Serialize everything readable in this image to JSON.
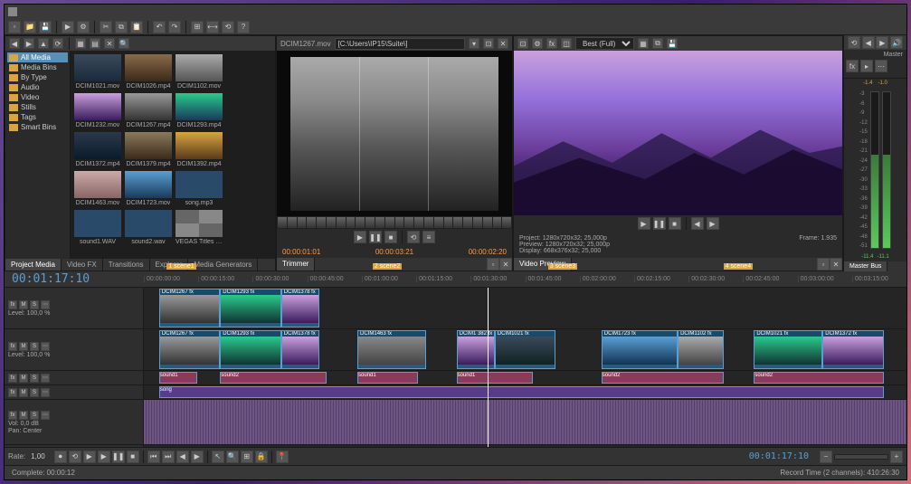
{
  "titlebar": {
    "app_icon": "□"
  },
  "media": {
    "tree": [
      "All Media",
      "Media Bins",
      "By Type",
      "Audio",
      "Video",
      "Stills",
      "Tags",
      "Smart Bins"
    ],
    "thumbs": [
      {
        "label": "DCIM1021.mov",
        "bg": "linear-gradient(#3a4a5a,#1a2a3a)"
      },
      {
        "label": "DCIM1026.mp4",
        "bg": "linear-gradient(#8a6a4a,#3a2a1a)"
      },
      {
        "label": "DCIM1102.mov",
        "bg": "linear-gradient(#aaa,#555)"
      },
      {
        "label": "DCIM1232.mov",
        "bg": "linear-gradient(#c9a0dc,#3a1c5e)"
      },
      {
        "label": "DCIM1267.mp4",
        "bg": "linear-gradient(#999,#333)"
      },
      {
        "label": "DCIM1293.mp4",
        "bg": "linear-gradient(#2aca8a,#1a3a5a)"
      },
      {
        "label": "DCIM1372.mp4",
        "bg": "linear-gradient(#2a3a4a,#0a1a2a)"
      },
      {
        "label": "DCIM1379.mp4",
        "bg": "linear-gradient(#8a7a5a,#3a2a1a)"
      },
      {
        "label": "DCIM1392.mp4",
        "bg": "linear-gradient(#d9a441,#5a3a1a)"
      },
      {
        "label": "DCIM1463.mov",
        "bg": "linear-gradient(#caa,#866)"
      },
      {
        "label": "DCIM1723.mov",
        "bg": "linear-gradient(#5a9fd4,#1a3a5a)"
      },
      {
        "label": "song.mp3",
        "bg": "#2a4a6a"
      },
      {
        "label": "sound1.WAV",
        "bg": "#2a4a6a"
      },
      {
        "label": "sound2.wav",
        "bg": "#2a4a6a"
      },
      {
        "label": "VEGAS Titles & Text abstract",
        "bg": "repeating-conic-gradient(#888 0 25%,#666 0 50%)"
      }
    ],
    "tabs": [
      "Project Media",
      "Video FX",
      "Transitions",
      "Explorer",
      "Media Generators"
    ]
  },
  "trimmer": {
    "file": "DCIM1267.mov",
    "path": "[C:\\Users\\IP15\\Suite\\]",
    "time_in": "00:00:01:01",
    "time_mid": "00:00:03:21",
    "time_out": "00:00:02:20",
    "footer_label": "Trimmer"
  },
  "preview": {
    "quality": "Best (Full)",
    "info": {
      "project": "1280x720x32; 25,000p",
      "preview": "1280x720x32; 25,000p",
      "display": "668x376x32; 25,000",
      "frame": "1.935",
      "footer_label": "Video Preview"
    }
  },
  "master": {
    "label": "Master",
    "peak_l": "-1.4",
    "peak_r": "-1.0",
    "meter_val_l": "-11.4",
    "meter_val_r": "-11.1",
    "footer_label": "Master Bus",
    "scale": [
      "-3",
      "-6",
      "-9",
      "-12",
      "-15",
      "-18",
      "-21",
      "-24",
      "-27",
      "-30",
      "-33",
      "-36",
      "-39",
      "-42",
      "-45",
      "-48",
      "-51"
    ]
  },
  "timeline": {
    "timecode": "00:01:17:10",
    "ruler": [
      "00:00:00:00",
      "00:00:15:00",
      "00:00:30:00",
      "00:00:45:00",
      "00:01:00:00",
      "00:01:15:00",
      "00:01:30:00",
      "00:01:45:00",
      "00:02:00:00",
      "00:02:15:00",
      "00:02:30:00",
      "00:02:45:00",
      "00:03:00:00",
      "00:03:15:00"
    ],
    "markers": [
      {
        "pos": 3,
        "label": "1 scene1"
      },
      {
        "pos": 30,
        "label": "2 scene2"
      },
      {
        "pos": 53,
        "label": "3 scene3"
      },
      {
        "pos": 76,
        "label": "4 scene4"
      }
    ],
    "tracks": [
      {
        "type": "video",
        "label": "Level: 100,0 %"
      },
      {
        "type": "video",
        "label": "Level: 100,0 %"
      },
      {
        "type": "audio",
        "label": ""
      },
      {
        "type": "audio",
        "label": ""
      },
      {
        "type": "wave",
        "label_vol": "Vol:",
        "val_vol": "0,0 dB",
        "label_pan": "Pan:",
        "val_pan": "Center"
      }
    ],
    "clips_v1": [
      {
        "l": 2,
        "w": 8,
        "label": "DCIM1267",
        "bg": "linear-gradient(#999,#333)"
      },
      {
        "l": 10,
        "w": 8,
        "label": "DCIM1293",
        "bg": "linear-gradient(#2aca8a,#133)"
      },
      {
        "l": 18,
        "w": 5,
        "label": "DCIM1378",
        "bg": "linear-gradient(#c9a0dc,#3a1c5e)"
      },
      {
        "l": 28,
        "w": 9,
        "label": "DCIM1463",
        "bg": "linear-gradient(#888,#444)"
      },
      {
        "l": 41,
        "w": 5,
        "label": "DCIM1 382",
        "bg": "linear-gradient(#c9a0dc,#3a1c5e)"
      },
      {
        "l": 46,
        "w": 8,
        "label": "DCIM1021",
        "bg": "linear-gradient(#3a4a5a,#122)"
      },
      {
        "l": 60,
        "w": 10,
        "label": "DCIM1723",
        "bg": "linear-gradient(#5a9fd4,#135)"
      },
      {
        "l": 70,
        "w": 6,
        "label": "DCIM1102",
        "bg": "linear-gradient(#aaa,#444)"
      },
      {
        "l": 80,
        "w": 9,
        "label": "DCIM1021",
        "bg": "linear-gradient(#2aca8a,#133)"
      },
      {
        "l": 89,
        "w": 8,
        "label": "DCIM1372",
        "bg": "linear-gradient(#c9a0dc,#3a1c5e)"
      }
    ],
    "clips_a1": [
      {
        "l": 2,
        "w": 5,
        "label": "sound1"
      },
      {
        "l": 10,
        "w": 14,
        "label": "sound2"
      },
      {
        "l": 28,
        "w": 8,
        "label": "sound1"
      },
      {
        "l": 41,
        "w": 10,
        "label": "sound1"
      },
      {
        "l": 60,
        "w": 16,
        "label": "sound2"
      },
      {
        "l": 80,
        "w": 17,
        "label": "sound2"
      }
    ],
    "clips_a2": [
      {
        "l": 2,
        "w": 95,
        "label": "song"
      }
    ],
    "rate_label": "Rate:",
    "rate_val": "1,00",
    "tc_right": "00:01:17:10"
  },
  "status": {
    "left": "Complete:  00:00:12",
    "right": "Record Time (2 channels): 410:26:30"
  }
}
